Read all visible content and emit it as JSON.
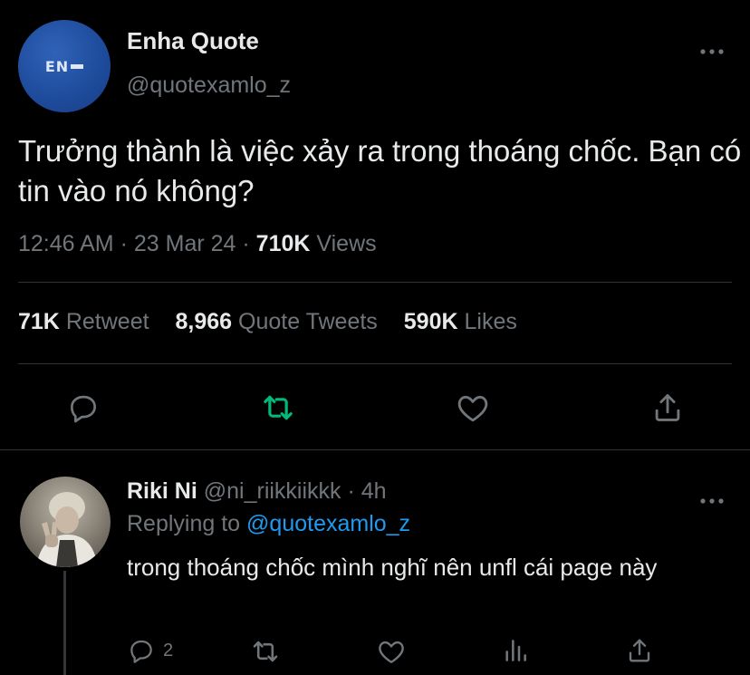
{
  "tweet": {
    "avatar_text": "EN",
    "display_name": "Enha Quote",
    "handle": "@quotexamlo_z",
    "more_icon": "ellipsis-icon",
    "text": "Trưởng thành là việc xảy ra trong thoáng chốc. Bạn có tin vào nó không?",
    "time": "12:46 AM",
    "date": "23 Mar 24",
    "separator": "·",
    "views_count": "710K",
    "views_label": "Views"
  },
  "stats": {
    "retweets_count": "71K",
    "retweets_label": "Retweet",
    "quotes_count": "8,966",
    "quotes_label": "Quote Tweets",
    "likes_count": "590K",
    "likes_label": "Likes"
  },
  "actions": {
    "icons": [
      "reply-icon",
      "retweet-icon",
      "like-icon",
      "share-icon"
    ],
    "retweet_active_color": "#00ba7c"
  },
  "reply": {
    "display_name": "Riki Ni",
    "handle": "@ni_riikkiikkk",
    "separator": "·",
    "age": "4h",
    "replying_prefix": "Replying to",
    "replying_handle": "@quotexamlo_z",
    "text": "trong thoáng chốc mình nghĩ nên unfl cái page này",
    "reply_count": "2",
    "icons": [
      "reply-icon",
      "retweet-icon",
      "like-icon",
      "views-icon",
      "share-icon"
    ]
  },
  "colors": {
    "background": "#000000",
    "text_primary": "#e7e9ea",
    "text_secondary": "#71767b",
    "link": "#1d9bf0",
    "divider": "#2f3336"
  }
}
